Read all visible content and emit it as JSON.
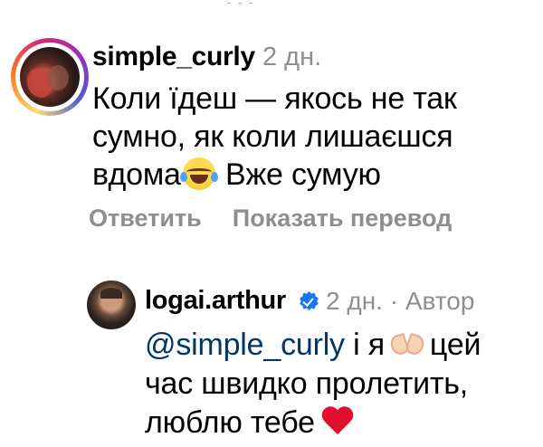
{
  "comment": {
    "username": "simple_curly",
    "time": "2 дн.",
    "text_part1": "Коли їдеш — якось не так сумно, як коли лишаєшся вдома",
    "emoji_laugh": "tears-of-joy-emoji",
    "text_part2": "Вже сумую",
    "reply_label": "Ответить",
    "translate_label": "Показать перевод"
  },
  "reply": {
    "username": "logai.arthur",
    "time": "2 дн.",
    "separator": "·",
    "author_label": "Автор",
    "mention": "@simple_curly",
    "text_part1": "і я",
    "emoji_hands": "heart-hands-emoji",
    "text_part2": "цей час швидко пролетить, люблю тебе",
    "emoji_heart": "red-heart-emoji"
  },
  "colors": {
    "secondary_text": "#8e8e8e",
    "mention": "#00376b",
    "verified": "#1877f2"
  }
}
